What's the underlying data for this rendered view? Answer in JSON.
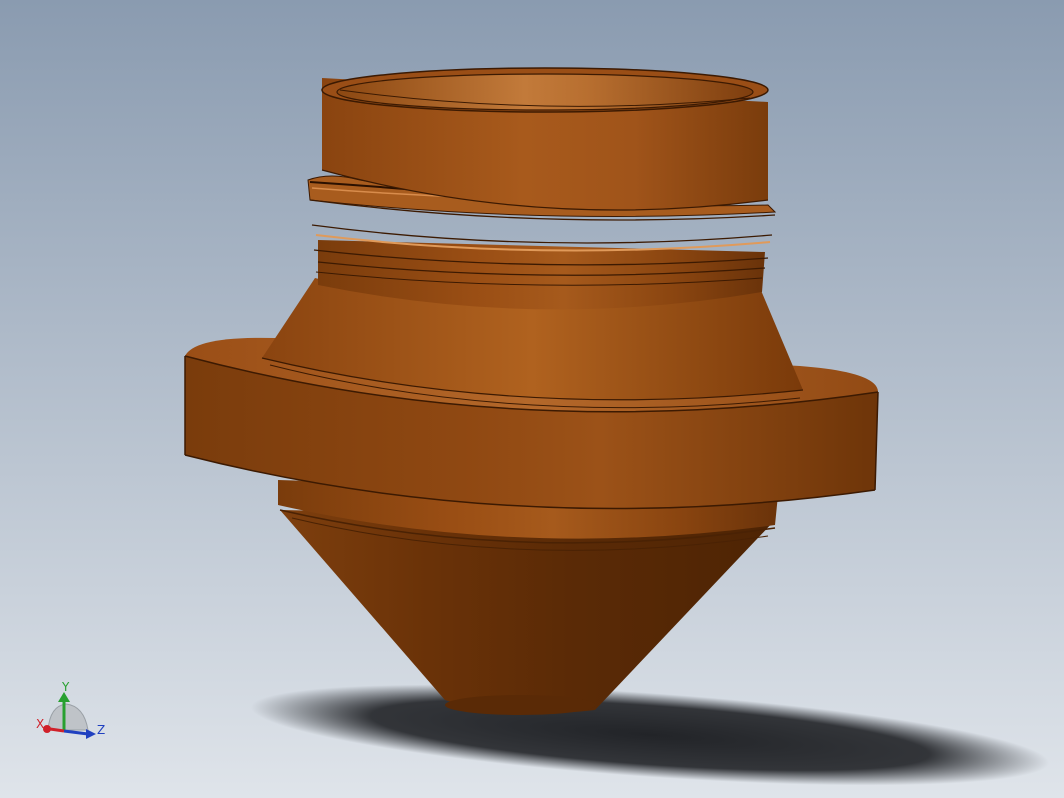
{
  "viewport": {
    "background_top": "#8a9bb0",
    "background_bottom": "#dfe4ea"
  },
  "model": {
    "part": "nozzle",
    "material_color": "#a0561a",
    "highlight_color": "#c87a3a",
    "shadow_color": "#5a2c0a",
    "ground_shadow_color": "#2a2c30"
  },
  "triad": {
    "x_label": "X",
    "y_label": "Y",
    "z_label": "Z",
    "x_color": "#d0202a",
    "y_color": "#28a030",
    "z_color": "#2040c0"
  }
}
